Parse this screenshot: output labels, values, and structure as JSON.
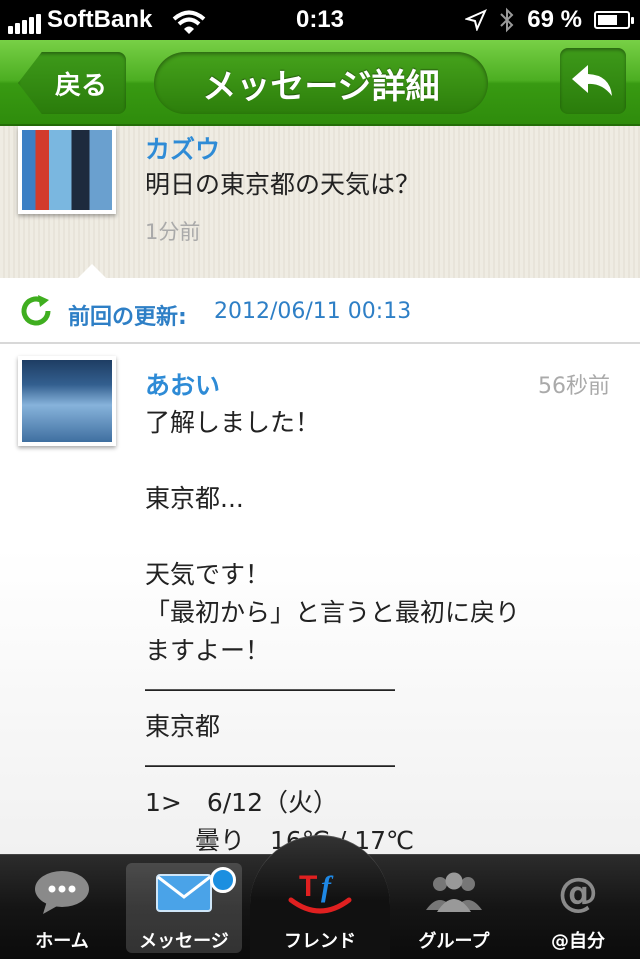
{
  "status_bar": {
    "carrier": "SoftBank",
    "time": "0:13",
    "battery_text": "69 %",
    "battery_level": 0.69
  },
  "navbar": {
    "back_label": "戻る",
    "title": "メッセージ詳細"
  },
  "previous_message": {
    "name": "カズウ",
    "text": "明日の東京都の天気は？",
    "time": "1分前"
  },
  "update_bar": {
    "label": "前回の更新:",
    "value": "2012/06/11 00:13"
  },
  "message": {
    "name": "あおい",
    "time": "56秒前",
    "text": "了解しました！\n\n東京都...\n\n天気です！\n「最初から」と言うと最初に戻り\nますよー！\n――――――――――\n東京都\n――――――――――\n1>　6/12（火）\n　　曇り　16℃ / 17℃"
  },
  "tabs": [
    {
      "label": "ホーム",
      "icon": "chat-bubble-icon"
    },
    {
      "label": "メッセージ",
      "icon": "envelope-icon"
    },
    {
      "label": "フレンド",
      "icon": "tf-logo-icon"
    },
    {
      "label": "グループ",
      "icon": "people-icon"
    },
    {
      "label": "@自分",
      "icon": "at-icon"
    }
  ],
  "colors": {
    "nav_green": "#4cae22",
    "link_blue": "#2e8bd6",
    "badge_blue": "#1b8fe0",
    "logo_red": "#e02020"
  }
}
